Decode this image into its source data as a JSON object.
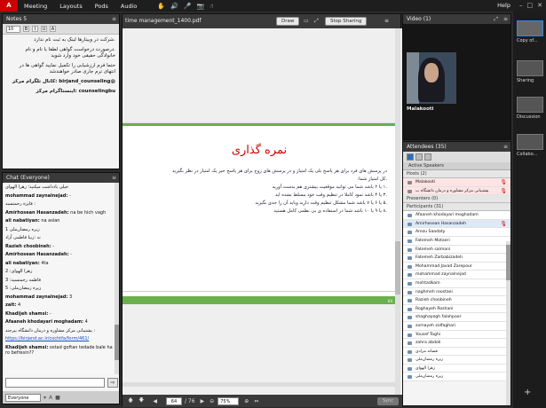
{
  "menu": {
    "items": [
      "Meeting",
      "Layouts",
      "Pods",
      "Audio"
    ],
    "help": "Help"
  },
  "notes": {
    "title": "Notes 5",
    "size": "10",
    "lines": [
      ".شرکت در وبینارها لینک به ثبت نام ندارد",
      ".درصورت درخواست گواهی لطفا یا نام و نام خانوادگی حقیقی خود وارد شوید",
      "حتما فرم ارزشیابی را تکمیل نمایید گواهی ها در انتهای ترم جاری صادر خواهندشد",
      "@birjand_counseling :کانال تلگرام مرکز",
      "counselingbu :اینستاگرام مرکز"
    ]
  },
  "chat": {
    "title": "Chat",
    "scope": "(Everyone)",
    "target": "Everyone",
    "messages": [
      {
        "name": "",
        "text": "خیلی یادداشت میکنید؛ زهرا الهوای"
      },
      {
        "name": "mohammad zaynalnejad:",
        "text": " -"
      },
      {
        "name": "",
        "text": "فایزه رحمتسید :"
      },
      {
        "name": "Amirhosean Hasanzadeh:",
        "text": " na be hich vagh"
      },
      {
        "name": "ali nabatiyan:",
        "text": " na aslan"
      },
      {
        "name": "",
        "text": "1 زیره رمضان‌ملی"
      },
      {
        "name": "",
        "text": "نه :زیبا فاطمی آزاد"
      },
      {
        "name": "Razieh choobineh:",
        "text": " -"
      },
      {
        "name": "Amirhosean Hasanzadeh:",
        "text": " -"
      },
      {
        "name": "ali nabatiyan:",
        "text": " 4ta"
      },
      {
        "name": "",
        "text": "2 :زهرا الهوای"
      },
      {
        "name": "",
        "text": "3 :فاطمه رحمتسید"
      },
      {
        "name": "",
        "text": "5 :زیره رمضان‌ملی"
      },
      {
        "name": "mohammad zaynalnejad:",
        "text": " 3"
      },
      {
        "name": "zalt:",
        "text": " 4"
      },
      {
        "name": "Khadijeh shamsi:",
        "text": " -"
      },
      {
        "name": "Afaaneh khodayari moghadam:",
        "text": " 4"
      },
      {
        "name": "",
        "text": "پشتیبانی مرکز مشاوره و درمان دانشگاه بیرجند :"
      },
      {
        "name": "",
        "text": "https://birjand.ac.ir/cochtfa/form/461/",
        "link": true
      },
      {
        "name": "Khadijeh shamsi:",
        "text": " ostad goftan tedade bale ha ro befresin??"
      }
    ]
  },
  "share": {
    "title": "time management_1400.pdf",
    "draw_label": "Draw",
    "stop_label": "Stop Sharing",
    "page_current": "64",
    "page_total": "/ 76",
    "zoom": "75%",
    "sync_label": "Sync",
    "slide": {
      "title": "نمره گذاری",
      "lines": [
        "در پرسش های فرد برای هر پاسخ بلی یک امتیاز و در پرسش های زوج برای هر پاسخ خیر یک امتیاز در نظر بگیرید",
        ".کل امتیاز شما:",
        ".۱ یا ۲ باشد شما می توانید موقعیت بیشتری هم بدست آورید",
        ".۳ یا ۴ باشد نمود کاملا در تنظیم وقت خود مسلط نشده اید",
        ".۵ یا ۶ یا ۷ باشد شما مشکل تنظیم وقت دارید وباید آن را جدی بگیرید",
        ".۸ یا ۹ یا ۱۰ باشد شما در استفاده ی بی نظمی کامل هستید"
      ],
      "page_number": "64"
    }
  },
  "video": {
    "title": "Video",
    "count": "(1)",
    "name": "Malakooti"
  },
  "attendees": {
    "title": "Attendees",
    "count": "(35)",
    "active_speakers": "Active Speakers",
    "hosts_label": "Hosts (2)",
    "hosts": [
      "Malakooti",
      "پشتیبانی مرکز مشاوره و درمان دانشگاه ب"
    ],
    "presenters_label": "Presenters (0)",
    "participants_label": "Participants (31)",
    "participants": [
      "Afaaneh khodayari moghadam",
      "Amirhosean Hasanzadeh",
      "Arezu Saadaty",
      "Fatemeh Motaeri",
      "Fatemeh salmani",
      "Fatemeh Zarbabizadeh",
      "Mohammad Javad Zarepour",
      "mohammad zaynalnejad",
      "mohtadkam",
      "naghmeh roostaei",
      "Razieh choobineh",
      "Roghayeh Roshani",
      "shaghayegh falahpoor",
      "somayeh zolfaghari",
      "Yousef Toghi",
      "zahra abdoli",
      "فسانه مرادی",
      "زیره رمضان‌ملی",
      "زهرا الهوای",
      "زیره رمضان‌ملی"
    ]
  },
  "rail": {
    "items": [
      "Copy of...",
      "Sharing",
      "Discussion",
      "Collabo..."
    ]
  }
}
